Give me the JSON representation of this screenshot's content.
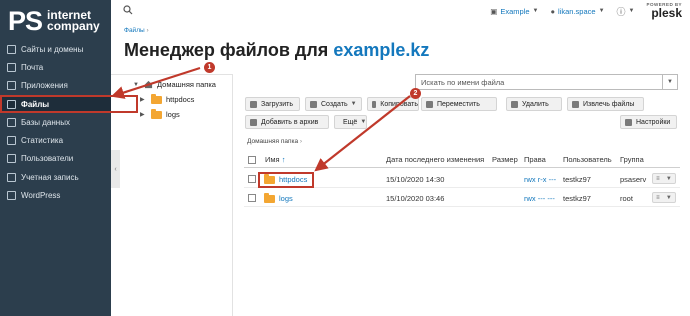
{
  "brand": {
    "logo_ps": "PS",
    "logo_line1": "internet",
    "logo_line2": "company"
  },
  "sidebar": {
    "items": [
      {
        "label": "Сайты и домены",
        "icon": "globe-icon"
      },
      {
        "label": "Почта",
        "icon": "mail-icon"
      },
      {
        "label": "Приложения",
        "icon": "apps-icon"
      },
      {
        "label": "Файлы",
        "icon": "folder-icon",
        "active": true
      },
      {
        "label": "Базы данных",
        "icon": "database-icon"
      },
      {
        "label": "Статистика",
        "icon": "stats-icon"
      },
      {
        "label": "Пользователи",
        "icon": "users-icon"
      },
      {
        "label": "Учетная запись",
        "icon": "account-icon"
      },
      {
        "label": "WordPress",
        "icon": "wordpress-icon"
      }
    ]
  },
  "topbar": {
    "subscription": "Example",
    "user": "likan.space",
    "powered_by": "POWERED BY",
    "plesk": "plesk"
  },
  "breadcrumb": "Файлы",
  "page_title": {
    "prefix": "Менеджер файлов для",
    "domain": "example.kz"
  },
  "tree": {
    "root": "Домашняя папка",
    "nodes": [
      "httpdocs",
      "logs"
    ]
  },
  "search": {
    "placeholder": "Искать по имени файла"
  },
  "toolbar": {
    "upload": "Загрузить",
    "create": "Создать",
    "copy": "Копировать",
    "move": "Переместить",
    "delete": "Удалить",
    "extract": "Извлечь файлы",
    "archive": "Добавить в архив",
    "more": "Ещё",
    "settings": "Настройки"
  },
  "path": "Домашняя папка",
  "table": {
    "headers": {
      "name": "Имя",
      "sort": "↑",
      "modified": "Дата последнего изменения",
      "size": "Размер",
      "perms": "Права",
      "user": "Пользователь",
      "group": "Группа"
    },
    "rows": [
      {
        "name": "httpdocs",
        "modified": "15/10/2020 14:30",
        "perms": "rwx r-x ---",
        "user": "testkz97",
        "group": "psaserv"
      },
      {
        "name": "logs",
        "modified": "15/10/2020 03:46",
        "perms": "rwx --- ---",
        "user": "testkz97",
        "group": "root"
      }
    ]
  },
  "annotations": {
    "badge1": "1",
    "badge2": "2"
  },
  "colors": {
    "sidebar": "#2c3e4d",
    "accent": "#1478bd",
    "annotation": "#c0392b",
    "folder": "#f3a632"
  }
}
